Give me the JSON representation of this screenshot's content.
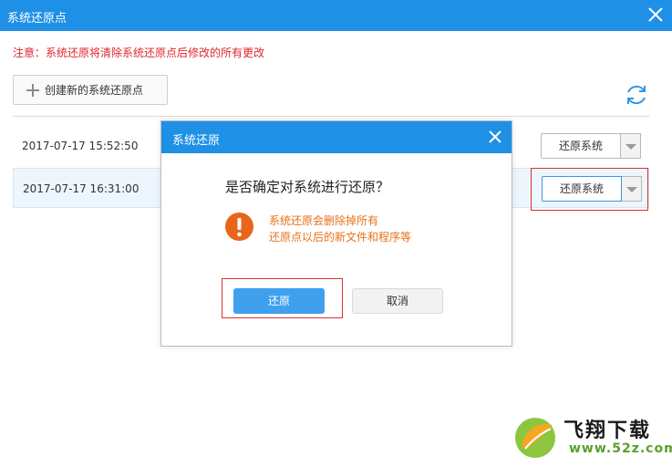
{
  "window": {
    "title": "系统还原点"
  },
  "notice": "注意：系统还原将清除系统还原点后修改的所有更改",
  "toolbar": {
    "create_label": "创建新的系统还原点"
  },
  "restore_points": [
    {
      "date": "2017-07-17 15:52:50",
      "button_label": "还原系统"
    },
    {
      "date": "2017-07-17 16:31:00",
      "button_label": "还原系统"
    }
  ],
  "dialog": {
    "title": "系统还原",
    "question": "是否确定对系统进行还原？",
    "warning_line1": "系统还原会删除掉所有",
    "warning_line2": "还原点以后的新文件和程序等",
    "ok_label": "还原",
    "cancel_label": "取消"
  },
  "watermark": {
    "brand": "飞翔下载",
    "domain": "www.52z.com"
  },
  "colors": {
    "accent": "#1e90e6",
    "notice": "#e0262b",
    "warning": "#e87019",
    "highlight_box": "#d9322f"
  },
  "icons": {
    "close": "close-icon",
    "refresh": "refresh-icon",
    "plus": "plus-icon",
    "warning": "exclamation-icon",
    "dropdown": "chevron-down-icon"
  }
}
